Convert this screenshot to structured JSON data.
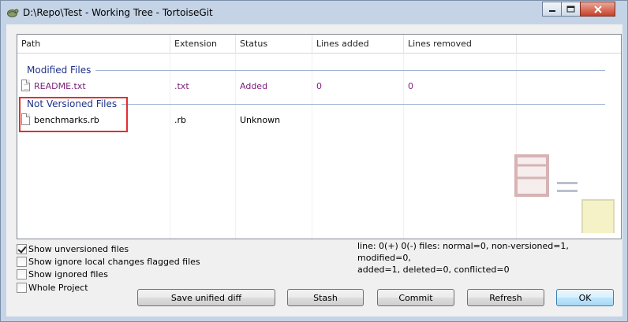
{
  "window": {
    "title": "D:\\Repo\\Test - Working Tree - TortoiseGit"
  },
  "columns": [
    "Path",
    "Extension",
    "Status",
    "Lines added",
    "Lines removed"
  ],
  "groups": [
    {
      "title": "Modified Files",
      "rows": [
        {
          "path": "README.txt",
          "extension": ".txt",
          "status": "Added",
          "lines_added": "0",
          "lines_removed": "0",
          "color": "#7a1e7a"
        }
      ]
    },
    {
      "title": "Not Versioned Files",
      "rows": [
        {
          "path": "benchmarks.rb",
          "extension": ".rb",
          "status": "Unknown",
          "lines_added": "",
          "lines_removed": "",
          "color": "#000000"
        }
      ]
    }
  ],
  "options": [
    {
      "label": "Show unversioned files",
      "checked": true
    },
    {
      "label": "Show ignore local changes flagged files",
      "checked": false
    },
    {
      "label": "Show ignored files",
      "checked": false
    },
    {
      "label": "Whole Project",
      "checked": false
    }
  ],
  "status_info": {
    "line1": "line: 0(+) 0(-) files: normal=0, non-versioned=1, modified=0,",
    "line2": "added=1, deleted=0, conflicted=0"
  },
  "buttons": {
    "save_diff": "Save unified diff",
    "stash": "Stash",
    "commit": "Commit",
    "refresh": "Refresh",
    "ok": "OK"
  },
  "colors": {
    "group_title": "#1e3287",
    "modified_text": "#7a1e7a",
    "highlight": "#e03030"
  }
}
